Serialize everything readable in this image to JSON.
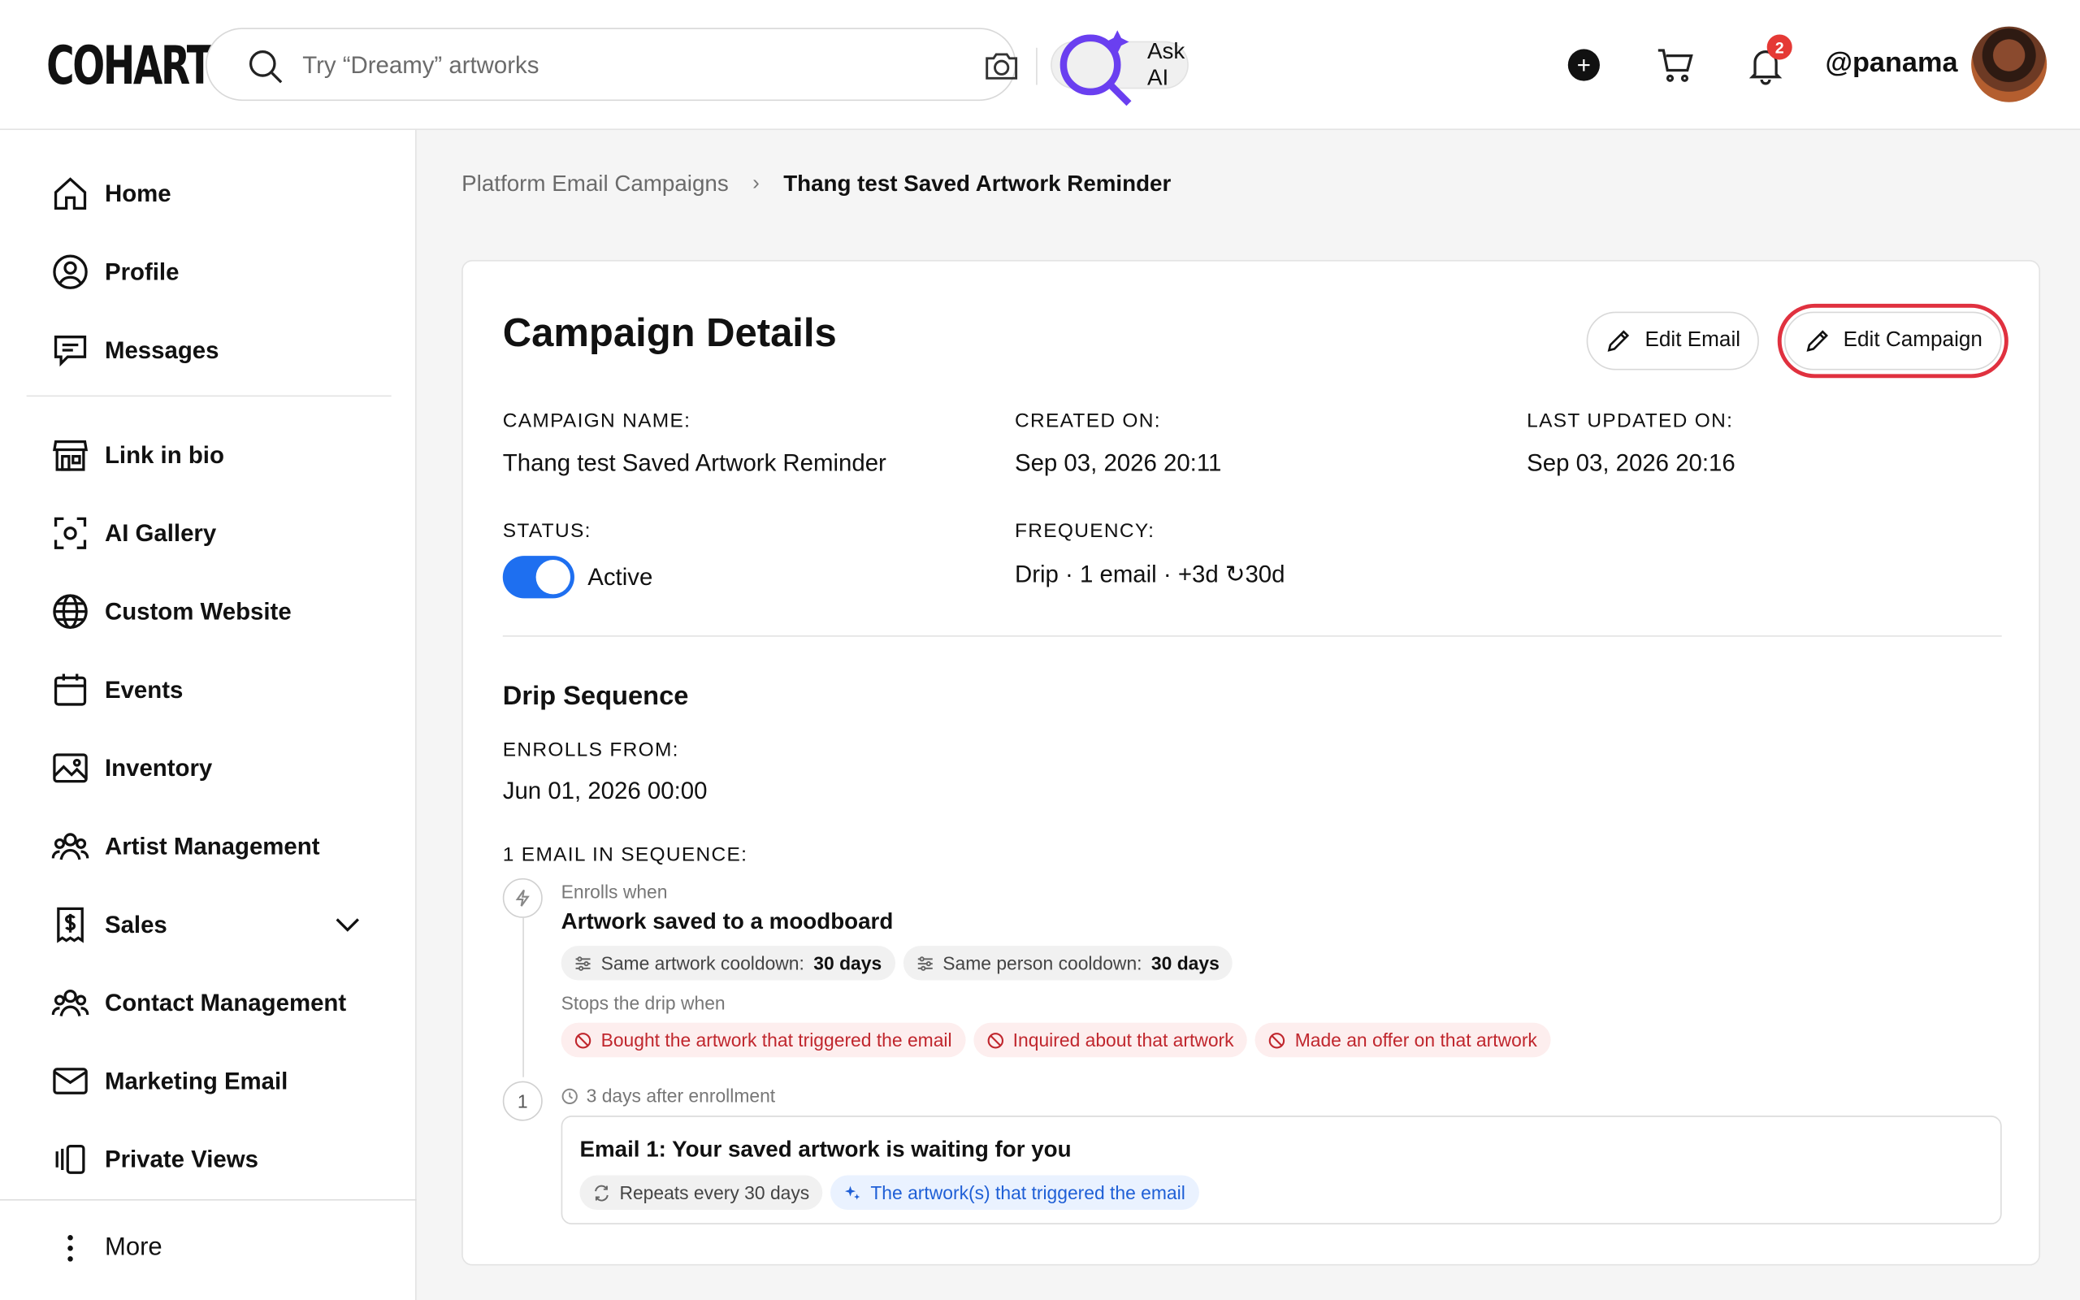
{
  "app": {
    "logo": "COHART"
  },
  "header": {
    "search_placeholder": "Try “Dreamy” artworks",
    "ask_ai_label": "Ask AI",
    "notification_count": "2",
    "username": "@panama"
  },
  "sidebar": {
    "items": [
      {
        "label": "Home",
        "icon": "home-icon"
      },
      {
        "label": "Profile",
        "icon": "profile-icon"
      },
      {
        "label": "Messages",
        "icon": "messages-icon"
      },
      {
        "label": "Link in bio",
        "icon": "storefront-icon"
      },
      {
        "label": "AI Gallery",
        "icon": "scan-icon"
      },
      {
        "label": "Custom Website",
        "icon": "globe-icon"
      },
      {
        "label": "Events",
        "icon": "calendar-icon"
      },
      {
        "label": "Inventory",
        "icon": "image-icon"
      },
      {
        "label": "Artist Management",
        "icon": "people-icon"
      },
      {
        "label": "Sales",
        "icon": "dollar-receipt-icon"
      },
      {
        "label": "Contact Management",
        "icon": "people-icon"
      },
      {
        "label": "Marketing Email",
        "icon": "mail-icon"
      },
      {
        "label": "Private Views",
        "icon": "private-views-icon"
      }
    ],
    "more_label": "More"
  },
  "breadcrumb": {
    "parent": "Platform Email Campaigns",
    "current": "Thang test Saved Artwork Reminder"
  },
  "campaign": {
    "title": "Campaign Details",
    "edit_email_label": "Edit Email",
    "edit_campaign_label": "Edit Campaign",
    "name_label": "CAMPAIGN NAME:",
    "name_value": "Thang test Saved Artwork Reminder",
    "created_label": "CREATED ON:",
    "created_value": "Sep 03, 2026 20:11",
    "updated_label": "LAST UPDATED ON:",
    "updated_value": "Sep 03, 2026 20:16",
    "status_label": "STATUS:",
    "status_value": "Active",
    "status_on": true,
    "frequency_label": "FREQUENCY:",
    "frequency_value": "Drip · 1 email · +3d ↻30d"
  },
  "drip": {
    "title": "Drip Sequence",
    "enrolls_from_label": "ENROLLS FROM:",
    "enrolls_from_value": "Jun 01, 2026 00:00",
    "count_label": "1 EMAIL IN SEQUENCE:",
    "enrolls_when_label": "Enrolls when",
    "trigger": "Artwork saved to a moodboard",
    "cooldowns": [
      {
        "label": "Same artwork cooldown:",
        "value": "30 days"
      },
      {
        "label": "Same person cooldown:",
        "value": "30 days"
      }
    ],
    "stops_label": "Stops the drip when",
    "stop_conditions": [
      "Bought the artwork that triggered the email",
      "Inquired about that artwork",
      "Made an offer on that artwork"
    ],
    "step_number": "1",
    "step_delay": "3 days after enrollment",
    "email_title": "Email 1: Your saved artwork is waiting for you",
    "repeat_chip": "Repeats every 30 days",
    "content_chip": "The artwork(s) that triggered the email"
  },
  "colors": {
    "accent": "#1e6ff0",
    "highlight": "#e0313f",
    "danger": "#c0262d"
  }
}
